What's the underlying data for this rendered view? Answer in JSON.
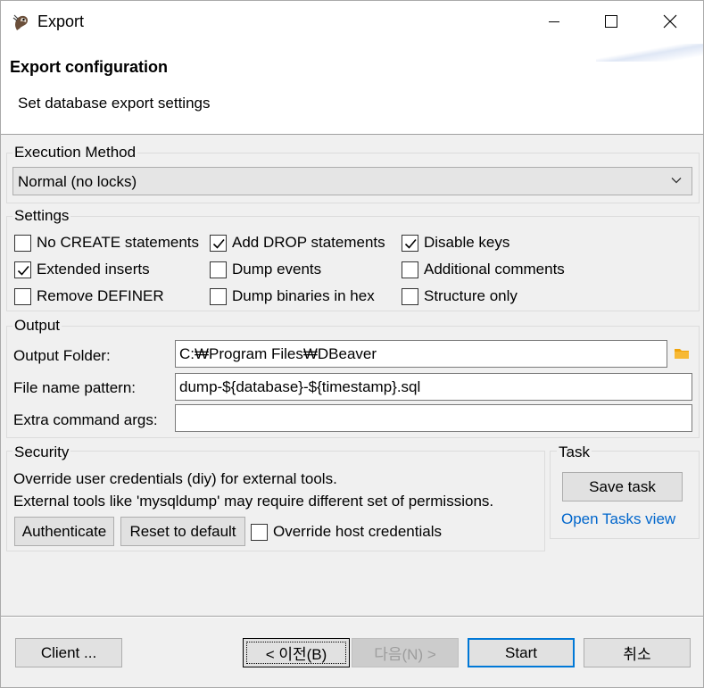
{
  "window": {
    "title": "Export"
  },
  "header": {
    "title": "Export configuration",
    "description": "Set database export settings"
  },
  "execution": {
    "group_label": "Execution Method",
    "selected": "Normal (no locks)"
  },
  "settings": {
    "group_label": "Settings",
    "no_create": {
      "label": "No CREATE statements",
      "checked": false
    },
    "add_drop": {
      "label": "Add DROP statements",
      "checked": true
    },
    "disable_keys": {
      "label": "Disable keys",
      "checked": true
    },
    "extended_inserts": {
      "label": "Extended inserts",
      "checked": true
    },
    "dump_events": {
      "label": "Dump events",
      "checked": false
    },
    "additional_comments": {
      "label": "Additional comments",
      "checked": false
    },
    "remove_definer": {
      "label": "Remove DEFINER",
      "checked": false
    },
    "dump_binaries_hex": {
      "label": "Dump binaries in hex",
      "checked": false
    },
    "structure_only": {
      "label": "Structure only",
      "checked": false
    }
  },
  "output": {
    "group_label": "Output",
    "folder_label": "Output Folder:",
    "folder_value": "C:₩Program Files₩DBeaver",
    "pattern_label": "File name pattern:",
    "pattern_value": "dump-${database}-${timestamp}.sql",
    "extra_label": "Extra command args:",
    "extra_value": "",
    "folder_icon": "folder-icon"
  },
  "security": {
    "group_label": "Security",
    "line1": "Override user credentials (diy) for external tools.",
    "line2": "External tools like 'mysqldump' may require different set of permissions.",
    "authenticate_label": "Authenticate",
    "reset_label": "Reset to default",
    "override_host": {
      "label": "Override host credentials",
      "checked": false
    }
  },
  "task": {
    "group_label": "Task",
    "save_label": "Save task",
    "open_link": "Open Tasks view"
  },
  "footer": {
    "client_label": "Client ...",
    "back_label": "< 이전(B)",
    "next_label": "다음(N) >",
    "start_label": "Start",
    "cancel_label": "취소"
  },
  "colors": {
    "accent": "#0078d7",
    "link": "#0066cc",
    "folder": "#f0a30a"
  }
}
